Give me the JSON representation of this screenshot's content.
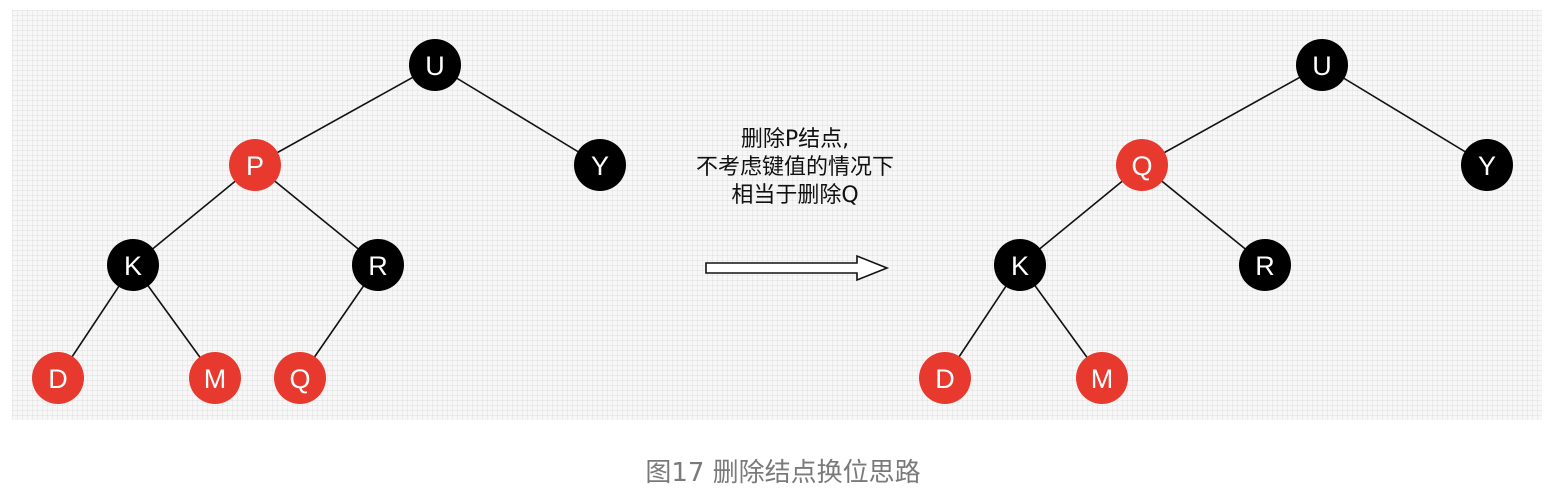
{
  "colors": {
    "red_node": "#e8392f",
    "black_node": "#000000",
    "edge": "#111111",
    "caption": "#7a7a7a"
  },
  "trees": [
    {
      "nodes": [
        {
          "id": "U",
          "label": "U",
          "color": "black"
        },
        {
          "id": "P",
          "label": "P",
          "color": "red"
        },
        {
          "id": "Y",
          "label": "Y",
          "color": "black"
        },
        {
          "id": "K",
          "label": "K",
          "color": "black"
        },
        {
          "id": "R",
          "label": "R",
          "color": "black"
        },
        {
          "id": "D",
          "label": "D",
          "color": "red"
        },
        {
          "id": "M",
          "label": "M",
          "color": "red"
        },
        {
          "id": "Q",
          "label": "Q",
          "color": "red"
        }
      ],
      "edges": [
        [
          "U",
          "P"
        ],
        [
          "U",
          "Y"
        ],
        [
          "P",
          "K"
        ],
        [
          "P",
          "R"
        ],
        [
          "K",
          "D"
        ],
        [
          "K",
          "M"
        ],
        [
          "R",
          "Q"
        ]
      ]
    },
    {
      "nodes": [
        {
          "id": "U",
          "label": "U",
          "color": "black"
        },
        {
          "id": "Q",
          "label": "Q",
          "color": "red"
        },
        {
          "id": "Y",
          "label": "Y",
          "color": "black"
        },
        {
          "id": "K",
          "label": "K",
          "color": "black"
        },
        {
          "id": "R",
          "label": "R",
          "color": "black"
        },
        {
          "id": "D",
          "label": "D",
          "color": "red"
        },
        {
          "id": "M",
          "label": "M",
          "color": "red"
        }
      ],
      "edges": [
        [
          "U",
          "Q"
        ],
        [
          "U",
          "Y"
        ],
        [
          "Q",
          "K"
        ],
        [
          "Q",
          "R"
        ],
        [
          "K",
          "D"
        ],
        [
          "K",
          "M"
        ]
      ]
    }
  ],
  "annotation": {
    "line1": "删除P结点,",
    "line2": "不考虑键值的情况下",
    "line3": "相当于删除Q"
  },
  "caption": "图17 删除结点换位思路"
}
